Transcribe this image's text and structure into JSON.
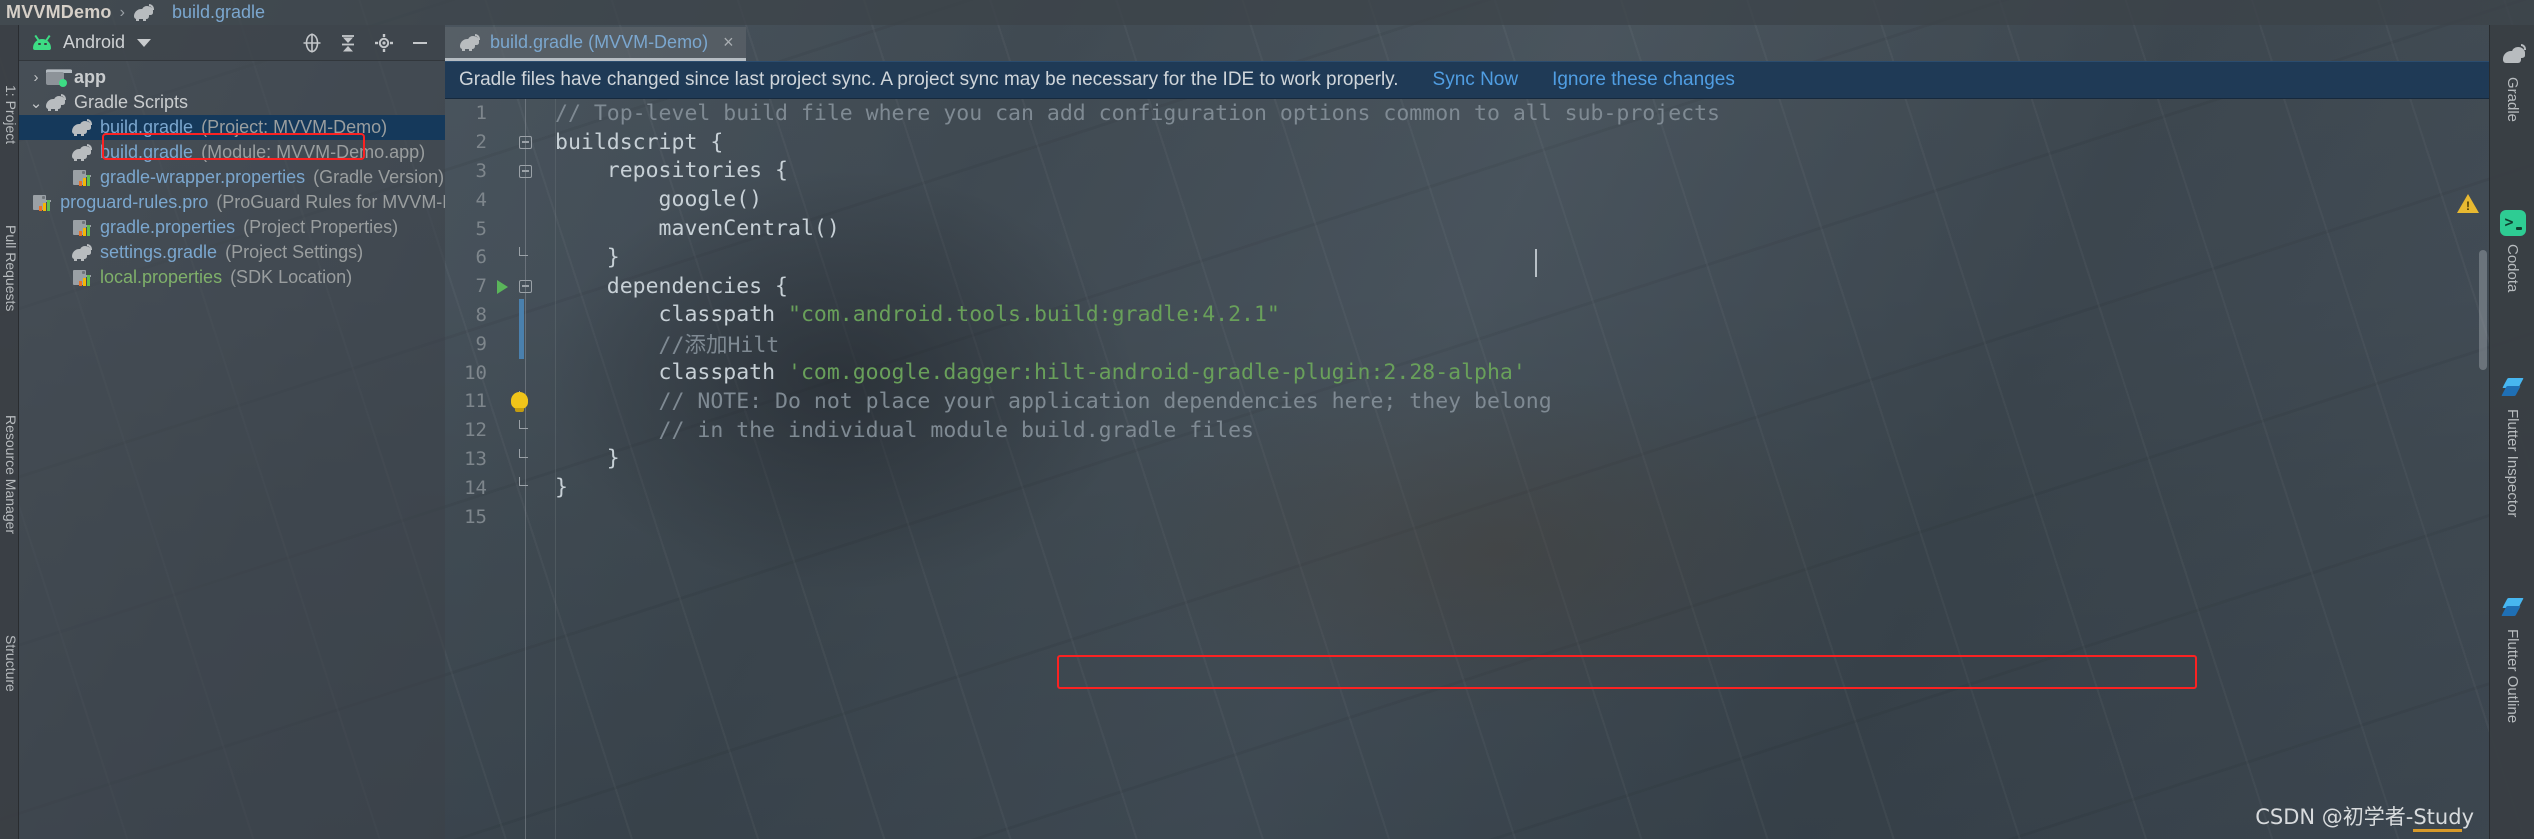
{
  "breadcrumb": {
    "project": "MVVMDemo",
    "separator": "›",
    "file": "build.gradle",
    "file_icon": "gradle-elephant-icon"
  },
  "left_strip": {
    "labels": [
      "1: Project",
      "Pull Requests",
      "Resource Manager",
      "Structure"
    ]
  },
  "project_panel": {
    "title": "Android",
    "title_icon": "android-robot-icon",
    "dropdown_icon": "chevron-down-icon",
    "toolbar_icons": [
      "locate-target-icon",
      "collapse-all-icon",
      "settings-gear-icon",
      "minimize-icon"
    ],
    "tree": [
      {
        "indent": 0,
        "twisty": "›",
        "icon": "folder-icon",
        "name": "app",
        "meta": "",
        "style": "plain",
        "selected": false
      },
      {
        "indent": 0,
        "twisty": "⌄",
        "icon": "gradle-elephant-icon",
        "name": "Gradle Scripts",
        "meta": "",
        "style": "plain-light",
        "selected": false
      },
      {
        "indent": 1,
        "twisty": "",
        "icon": "gradle-elephant-icon",
        "name": "build.gradle",
        "meta": "(Project: MVVM-Demo)",
        "style": "link",
        "selected": true
      },
      {
        "indent": 1,
        "twisty": "",
        "icon": "gradle-elephant-icon",
        "name": "build.gradle",
        "meta": "(Module: MVVM-Demo.app)",
        "style": "link",
        "selected": false
      },
      {
        "indent": 1,
        "twisty": "",
        "icon": "properties-file-icon",
        "name": "gradle-wrapper.properties",
        "meta": "(Gradle Version)",
        "style": "link",
        "selected": false
      },
      {
        "indent": 1,
        "twisty": "",
        "icon": "properties-file-icon",
        "name": "proguard-rules.pro",
        "meta": "(ProGuard Rules for MVVM-De",
        "style": "link",
        "selected": false
      },
      {
        "indent": 1,
        "twisty": "",
        "icon": "properties-file-icon",
        "name": "gradle.properties",
        "meta": "(Project Properties)",
        "style": "link",
        "selected": false
      },
      {
        "indent": 1,
        "twisty": "",
        "icon": "gradle-elephant-icon",
        "name": "settings.gradle",
        "meta": "(Project Settings)",
        "style": "link",
        "selected": false
      },
      {
        "indent": 1,
        "twisty": "",
        "icon": "properties-file-icon",
        "name": "local.properties",
        "meta": "(SDK Location)",
        "style": "green",
        "selected": false
      }
    ]
  },
  "editor": {
    "tab": {
      "icon": "gradle-elephant-icon",
      "label": "build.gradle (MVVM-Demo)",
      "close_icon": "×"
    },
    "notification": {
      "message": "Gradle files have changed since last project sync. A project sync may be necessary for the IDE to work properly.",
      "actions": [
        "Sync Now",
        "Ignore these changes"
      ],
      "background": "#1f3a56",
      "link_color": "#509ee3"
    },
    "lines": [
      {
        "n": "1",
        "gutter": "none",
        "html": "<span class='c-comment'>// Top-level build file where you can add configuration options common to all sub-projects</span>",
        "indent": 0
      },
      {
        "n": "2",
        "gutter": "fold",
        "html": "<span class='c-kw'>buildscript {</span>",
        "indent": 0
      },
      {
        "n": "3",
        "gutter": "fold",
        "html": "<span class='c-kw'>    repositories {</span>",
        "indent": 0
      },
      {
        "n": "4",
        "gutter": "none",
        "html": "<span class='c-kw'>        google()</span>",
        "indent": 0
      },
      {
        "n": "5",
        "gutter": "none",
        "html": "<span class='c-kw'>        mavenCentral()</span>",
        "indent": 0
      },
      {
        "n": "6",
        "gutter": "foldend",
        "html": "<span class='c-kw'>    }</span>",
        "indent": 0
      },
      {
        "n": "7",
        "gutter": "run-fold",
        "html": "<span class='c-kw'>    dependencies {</span>",
        "indent": 0
      },
      {
        "n": "8",
        "gutter": "none",
        "html": "<span class='c-kw'>        classpath </span><span class='c-str'>\"com.android.tools.build:gradle:4.2.1\"</span>",
        "indent": 0
      },
      {
        "n": "9",
        "gutter": "none",
        "html": "<span class='c-comment'>        //添加Hilt</span>",
        "indent": 0
      },
      {
        "n": "10",
        "gutter": "none",
        "html": "<span class='c-kw'>        classpath </span><span class='c-str'>'com.google.dagger:hilt-android-gradle-plugin:2.28-alpha'</span>",
        "indent": 0
      },
      {
        "n": "11",
        "gutter": "bulb-fold",
        "html": "<span class='c-comment'>        // NOTE: Do not place your application dependencies here; they belong</span>",
        "indent": 0
      },
      {
        "n": "12",
        "gutter": "foldend",
        "html": "<span class='c-comment'>        // in the individual module build.gradle files</span>",
        "indent": 0
      },
      {
        "n": "13",
        "gutter": "foldend",
        "html": "<span class='c-kw'>    }</span>",
        "indent": 0
      },
      {
        "n": "14",
        "gutter": "foldend",
        "html": "<span class='c-kw'>}</span>",
        "indent": 0
      },
      {
        "n": "15",
        "gutter": "none",
        "html": "",
        "indent": 0
      }
    ],
    "warning_icon": "warning-triangle-icon"
  },
  "right_strip": {
    "items": [
      {
        "icon": "gradle-elephant-icon",
        "label": "Gradle"
      },
      {
        "icon": "codota-icon",
        "label": "Codota"
      },
      {
        "icon": "flutter-icon",
        "label": "Flutter Inspector"
      },
      {
        "icon": "flutter-icon",
        "label": "Flutter Outline"
      }
    ]
  },
  "watermark": {
    "prefix": "CSDN @初学者-",
    "suffix": "Stud",
    "tail": "y"
  }
}
